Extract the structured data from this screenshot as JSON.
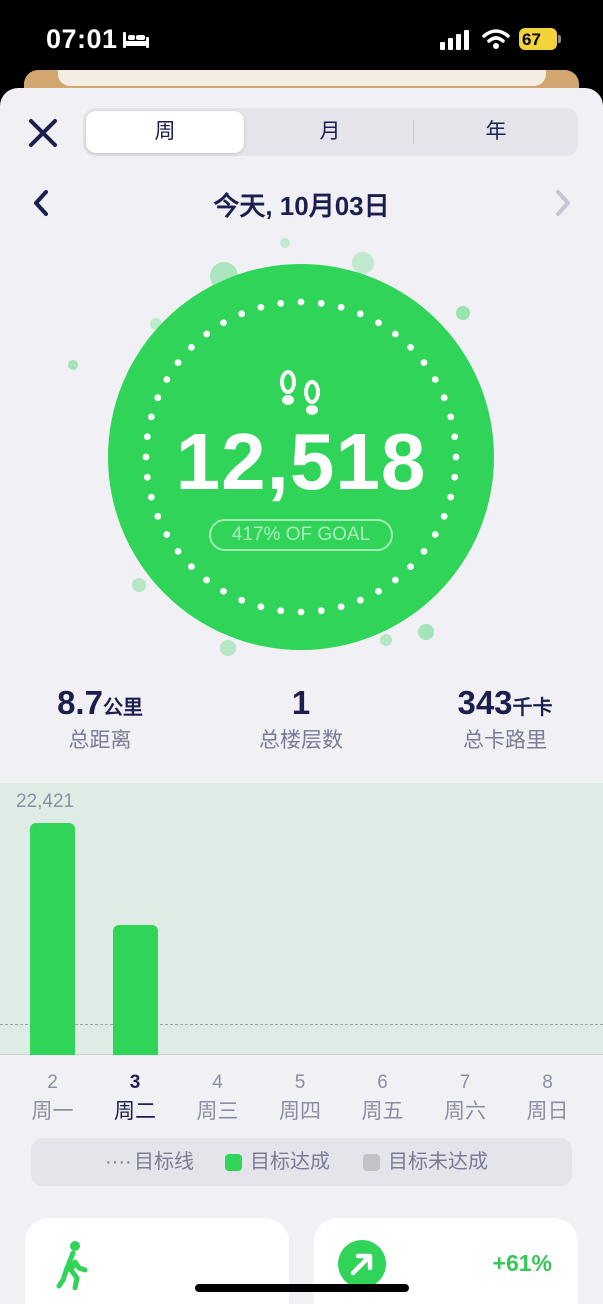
{
  "status": {
    "time": "07:01",
    "battery": "67",
    "icons": [
      "bed-icon",
      "signal-icon",
      "wifi-icon",
      "battery-icon"
    ]
  },
  "header": {
    "close_icon": "close-icon",
    "segments": [
      {
        "label": "周",
        "active": true
      },
      {
        "label": "月",
        "active": false
      },
      {
        "label": "年",
        "active": false
      }
    ]
  },
  "date": {
    "title": "今天, 10月03日",
    "prev_icon": "chevron-left-icon",
    "next_icon": "chevron-right-icon"
  },
  "ring": {
    "steps": "12,518",
    "goal_text": "417% OF GOAL",
    "icon": "footsteps-icon",
    "color": "#2fd459"
  },
  "stats": [
    {
      "value": "8.7",
      "unit": "公里",
      "label": "总距离"
    },
    {
      "value": "1",
      "unit": "",
      "label": "总楼层数"
    },
    {
      "value": "343",
      "unit": "千卡",
      "label": "总卡路里"
    }
  ],
  "chart_data": {
    "type": "bar",
    "categories": [
      "2",
      "3",
      "4",
      "5",
      "6",
      "7",
      "8"
    ],
    "day_names": [
      "周一",
      "周二",
      "周三",
      "周四",
      "周五",
      "周六",
      "周日"
    ],
    "values": [
      22421,
      12518,
      null,
      null,
      null,
      null,
      null
    ],
    "max_label": "22,421",
    "ylim": [
      0,
      22421
    ],
    "goal": 3000,
    "selected_index": 1,
    "bar_color": "#2fd459"
  },
  "legend": {
    "goal_line": "目标线",
    "reached": "目标达成",
    "not_reached": "目标未达成",
    "reached_color": "#2fd459",
    "not_reached_color": "#c2c2c7"
  },
  "cards": [
    {
      "icon": "walking-person-icon"
    },
    {
      "icon": "arrow-up-right-icon",
      "change": "+61%"
    }
  ]
}
